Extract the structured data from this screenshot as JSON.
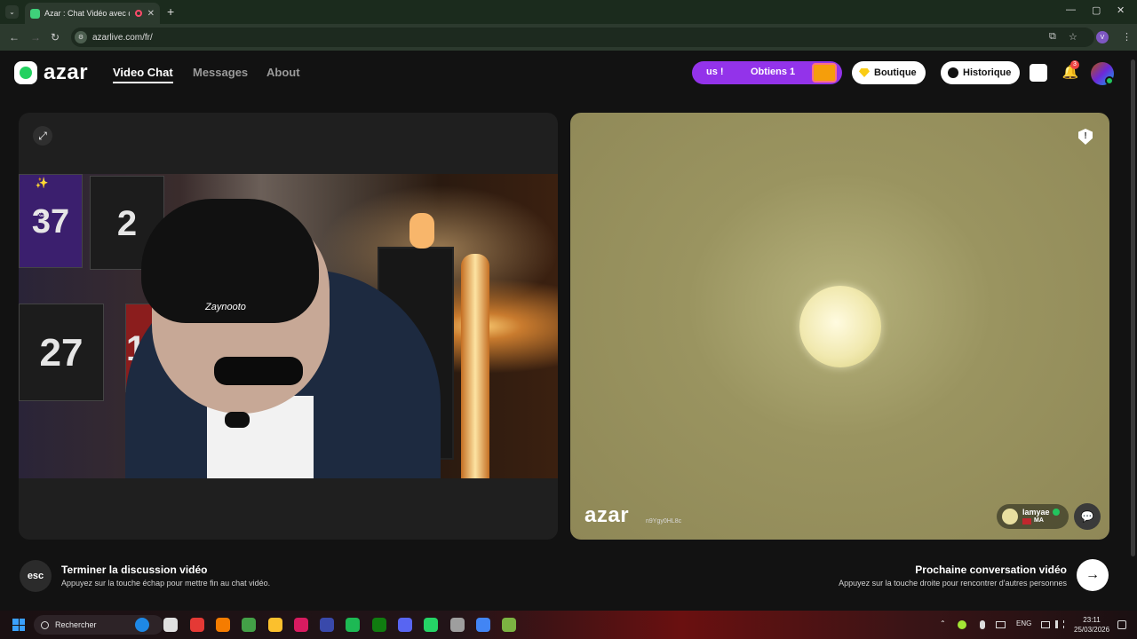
{
  "browser": {
    "tab_title": "Azar : Chat Vidéo avec de n",
    "tab_close": "✕",
    "tab_down": "⌄",
    "new_tab": "+",
    "url": "azarlive.com/fr/",
    "profile_initial": "V",
    "window": {
      "min": "—",
      "max": "▢",
      "close": "✕"
    },
    "nav": {
      "back": "←",
      "forward": "→",
      "reload": "↻",
      "install": "⧉",
      "star": "☆",
      "menu": "⋮"
    }
  },
  "site": {
    "logo_word": "azar",
    "nav": [
      {
        "label": "Video Chat",
        "active": true
      },
      {
        "label": "Messages",
        "active": false
      },
      {
        "label": "About",
        "active": false
      }
    ],
    "promo": {
      "left_text": "us !",
      "right_text": "Obtiens 1"
    },
    "boutique": "Boutique",
    "historique": "Historique",
    "notification_count": "3",
    "bell": "🔔"
  },
  "left_panel": {
    "jerseys": {
      "j1": "37",
      "j2": "2",
      "j3": "27",
      "j4": "10"
    },
    "cap_logo": "Zaynooto",
    "expand_icon": "⤢",
    "effects_icon": "✨",
    "sticker_icon": "☺"
  },
  "right_panel": {
    "watermark": "azar",
    "watermark_id": "n9Ygy0HL8c",
    "report": "!",
    "peer": {
      "name": "lamyae",
      "country": "MA"
    },
    "chat_icon": "💬"
  },
  "footer": {
    "esc_label": "esc",
    "end_title": "Terminer la discussion vidéo",
    "end_sub": "Appuyez sur la touche échap pour mettre fin au chat vidéo.",
    "next_title": "Prochaine conversation vidéo",
    "next_sub": "Appuyez sur la touche droite pour rencontrer d'autres personnes",
    "next_icon": "→"
  },
  "taskbar": {
    "search_placeholder": "Rechercher",
    "lang": "ENG",
    "time": "23:11",
    "date": "25/03/2026",
    "chevron": "⌃",
    "app_colors": [
      "#1e88e5",
      "#e0e0e0",
      "#e53935",
      "#f57c00",
      "#43a047",
      "#fbc02d",
      "#d81b60",
      "#3949ab",
      "#1db954",
      "#107c10",
      "#5865f2",
      "#25d366",
      "#9e9e9e",
      "#4285f4",
      "#7cb342"
    ]
  }
}
